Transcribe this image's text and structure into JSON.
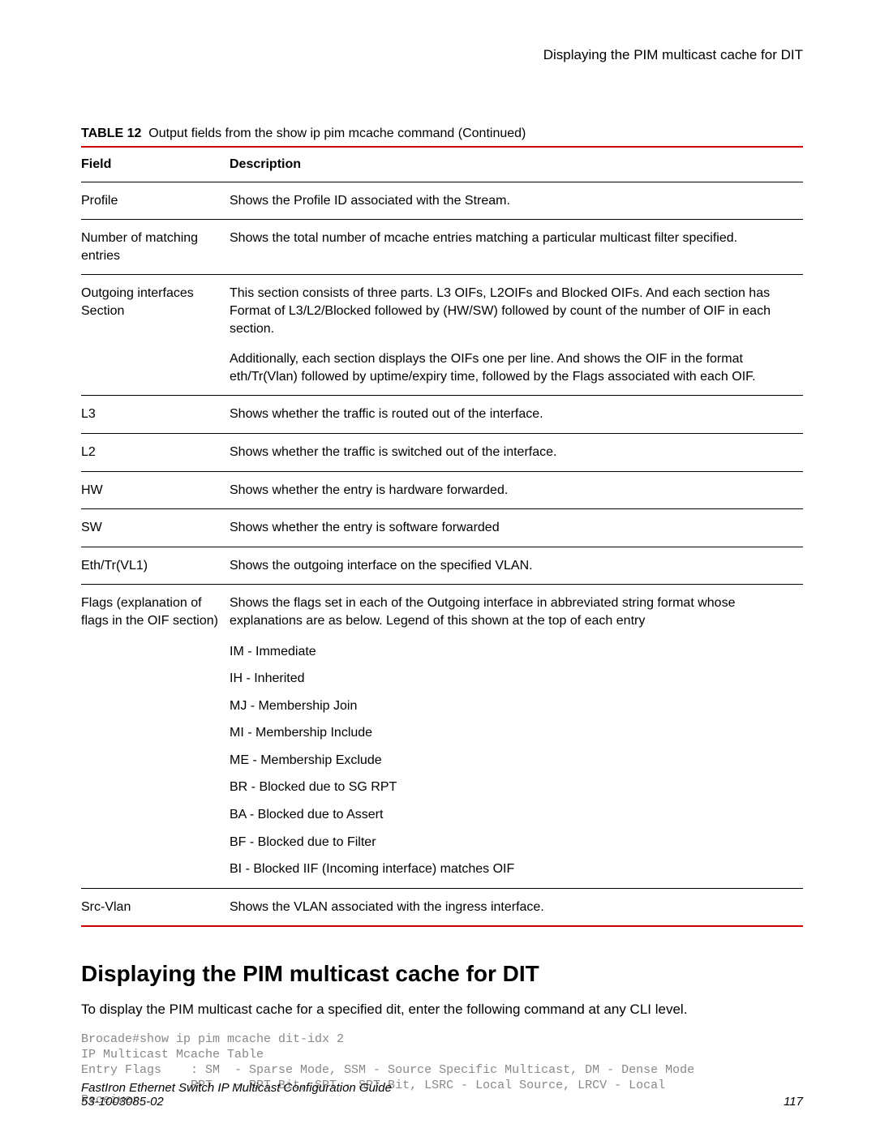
{
  "header": {
    "running_title": "Displaying the PIM multicast cache for DIT"
  },
  "table": {
    "label": "TABLE 12",
    "caption": "Output fields from the show ip pim mcache command (Continued)",
    "columns": {
      "field": "Field",
      "description": "Description"
    },
    "rows": {
      "profile": {
        "field": "Profile",
        "desc": "Shows the Profile ID associated with the Stream."
      },
      "num_matching": {
        "field": "Number of matching entries",
        "desc": "Shows the total number of mcache entries matching a particular multicast filter specified."
      },
      "outgoing": {
        "field": "Outgoing interfaces Section",
        "desc1": "This section consists of three parts. L3 OIFs, L2OIFs and Blocked OIFs. And each section has Format of L3/L2/Blocked followed by (HW/SW) followed by count of the number of OIF in each section.",
        "desc2": "Additionally, each section displays the OIFs one per line. And shows the OIF in the format eth/Tr(Vlan) followed by uptime/expiry time, followed by the Flags associated with each OIF."
      },
      "l3": {
        "field": "L3",
        "desc": "Shows whether the traffic is routed out of the interface."
      },
      "l2": {
        "field": "L2",
        "desc": "Shows whether the traffic is switched out of the interface."
      },
      "hw": {
        "field": "HW",
        "desc": "Shows whether the entry is hardware forwarded."
      },
      "sw": {
        "field": "SW",
        "desc": "Shows whether the entry is software forwarded"
      },
      "eth": {
        "field": "Eth/Tr(VL1)",
        "desc": "Shows the outgoing interface on the specified VLAN."
      },
      "flags": {
        "field": "Flags (explanation of flags in the OIF section)",
        "desc": "Shows the flags set in each of the Outgoing interface in abbreviated string format whose explanations are as below. Legend of this shown at the top of each entry",
        "items": {
          "im": "IM - Immediate",
          "ih": "IH - Inherited",
          "mj": "MJ - Membership Join",
          "mi": "MI - Membership Include",
          "me": "ME - Membership Exclude",
          "br": "BR - Blocked due to SG RPT",
          "ba": "BA - Blocked due to Assert",
          "bf": "BF - Blocked due to Filter",
          "bi": "BI - Blocked IIF (Incoming interface) matches OIF"
        }
      },
      "srcvlan": {
        "field": "Src-Vlan",
        "desc": "Shows the VLAN associated with the ingress interface."
      }
    }
  },
  "section": {
    "title": "Displaying the PIM multicast cache for DIT",
    "intro": "To display the PIM multicast cache for a specified dit, enter the following command at any CLI level.",
    "cli": "Brocade#show ip pim mcache dit-idx 2\nIP Multicast Mcache Table\nEntry Flags    : SM  - Sparse Mode, SSM - Source Specific Multicast, DM - Dense Mode\n               RPT   - RPT Bit, SPT - SPT Bit, LSRC - Local Source, LRCV - Local\nReceiver"
  },
  "footer": {
    "left1": "FastIron Ethernet Switch IP Multicast Configuration Guide",
    "left2": "53-1003085-02",
    "page": "117"
  }
}
